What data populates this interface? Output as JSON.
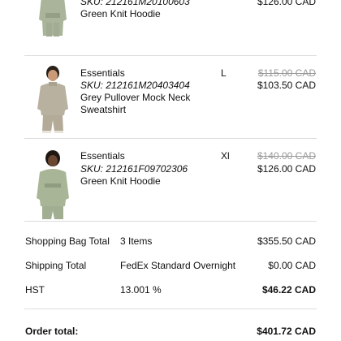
{
  "items": [
    {
      "brand": "",
      "sku": "SKU: 212161M20100603",
      "name": "Green Knit Hoodie",
      "size": "",
      "original_price": "",
      "price": "$126.00 CAD",
      "color": "#aab49a"
    },
    {
      "brand": "Essentials",
      "sku": "SKU: 212161M20403404",
      "name": "Grey Pullover Mock Neck Sweatshirt",
      "size": "L",
      "original_price": "$115.00 CAD",
      "price": "$103.50 CAD",
      "color": "#b9b19f"
    },
    {
      "brand": "Essentials",
      "sku": "SKU: 212161F09702306",
      "name": "Green Knit Hoodie",
      "size": "Xl",
      "original_price": "$140.00 CAD",
      "price": "$126.00 CAD",
      "color": "#a8b597"
    }
  ],
  "summary": {
    "bag": {
      "label": "Shopping Bag Total",
      "mid": "3 Items",
      "value": "$355.50 CAD"
    },
    "shipping": {
      "label": "Shipping Total",
      "mid": "FedEx Standard Overnight",
      "value": "$0.00 CAD"
    },
    "hst": {
      "label": "HST",
      "mid": "13.001 %",
      "value": "$46.22 CAD"
    },
    "order_total": {
      "label": "Order total:",
      "value": "$401.72 CAD"
    }
  }
}
